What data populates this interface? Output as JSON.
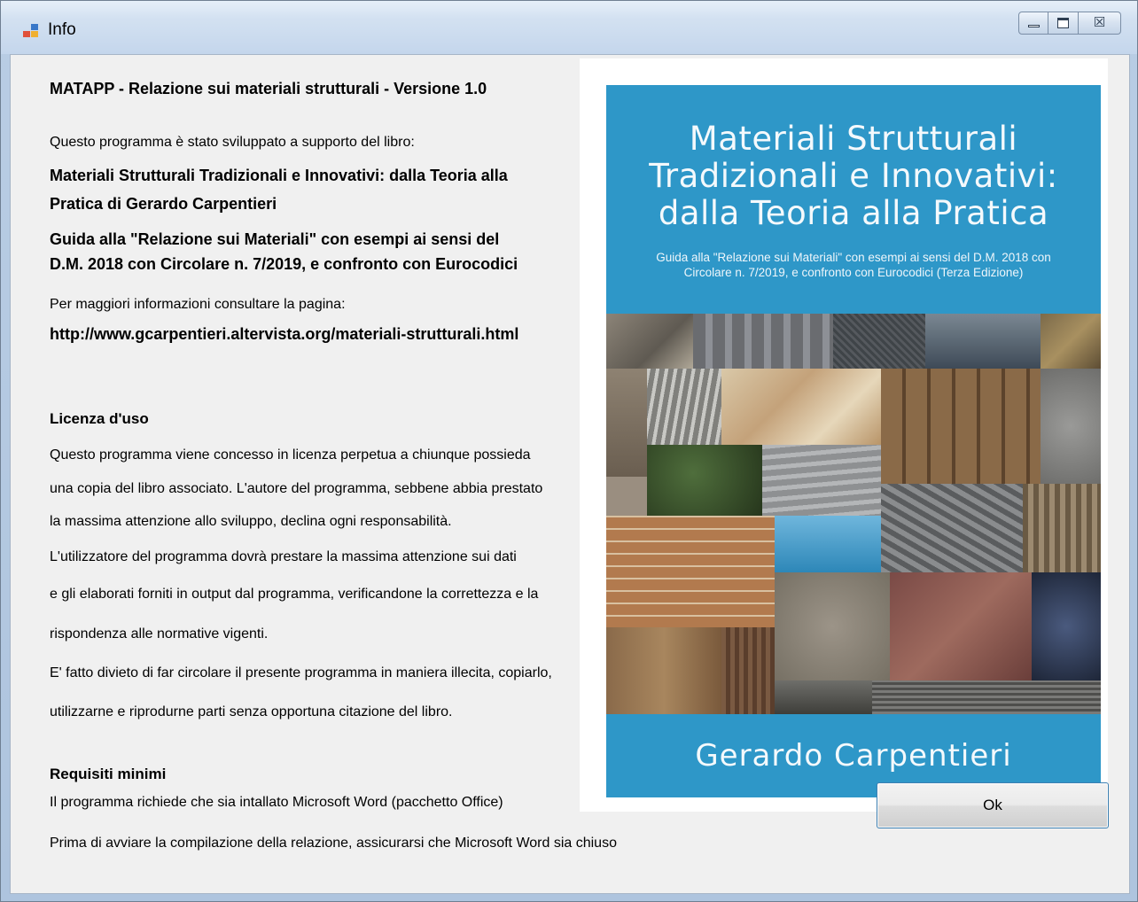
{
  "window": {
    "title": "Info",
    "icon": "app-window-icon",
    "caption_buttons": [
      "minimize",
      "maximize",
      "close"
    ],
    "close_glyph": "☒"
  },
  "content": {
    "app_title": "MATAPP - Relazione sui materiali strutturali - Versione 1.0",
    "intro": "Questo programma è stato sviluppato a supporto del libro:",
    "book_line1": "Materiali Strutturali Tradizionali e Innovativi: dalla Teoria alla",
    "book_line2": "Pratica di Gerardo Carpentieri",
    "guide_line1": "Guida alla \"Relazione sui Materiali\" con esempi ai sensi del",
    "guide_line2": "D.M. 2018 con Circolare n. 7/2019, e confronto con Eurocodici",
    "more_info": "Per maggiori informazioni consultare la pagina:",
    "url": "http://www.gcarpentieri.altervista.org/materiali-strutturali.html",
    "license_heading": "Licenza d'uso",
    "license_lines": [
      "Questo programma viene concesso in licenza perpetua a chiunque possieda",
      "una copia del libro associato. L'autore del programma, sebbene abbia prestato",
      "la massima attenzione allo sviluppo, declina ogni responsabilità.",
      "L'utilizzatore del programma dovrà prestare la massima attenzione sui dati",
      "e gli elaborati forniti in output dal programma, verificandone la correttezza e la",
      "rispondenza alle normative vigenti.",
      "E' fatto divieto di far circolare il presente programma in maniera illecita, copiarlo,",
      "utilizzarne e riprodurne parti senza opportuna citazione del libro."
    ],
    "requirements_heading": "Requisiti minimi",
    "requirements_line": "Il programma richiede che sia intallato Microsoft Word (pacchetto Office)",
    "warning_line": "Prima di avviare la compilazione della relazione, assicurarsi che Microsoft Word sia chiuso"
  },
  "cover": {
    "title_lines": [
      "Materiali Strutturali",
      "Tradizionali e Innovativi:",
      "dalla Teoria alla Pratica"
    ],
    "subtitle_lines": [
      "Guida alla \"Relazione sui Materiali\" con esempi ai sensi del D.M. 2018 con",
      "Circolare n. 7/2019, e confronto con Eurocodici (Terza Edizione)"
    ],
    "author": "Gerardo Carpentieri",
    "background_color": "#2e97c8"
  },
  "ok_button": {
    "label": "Ok"
  }
}
